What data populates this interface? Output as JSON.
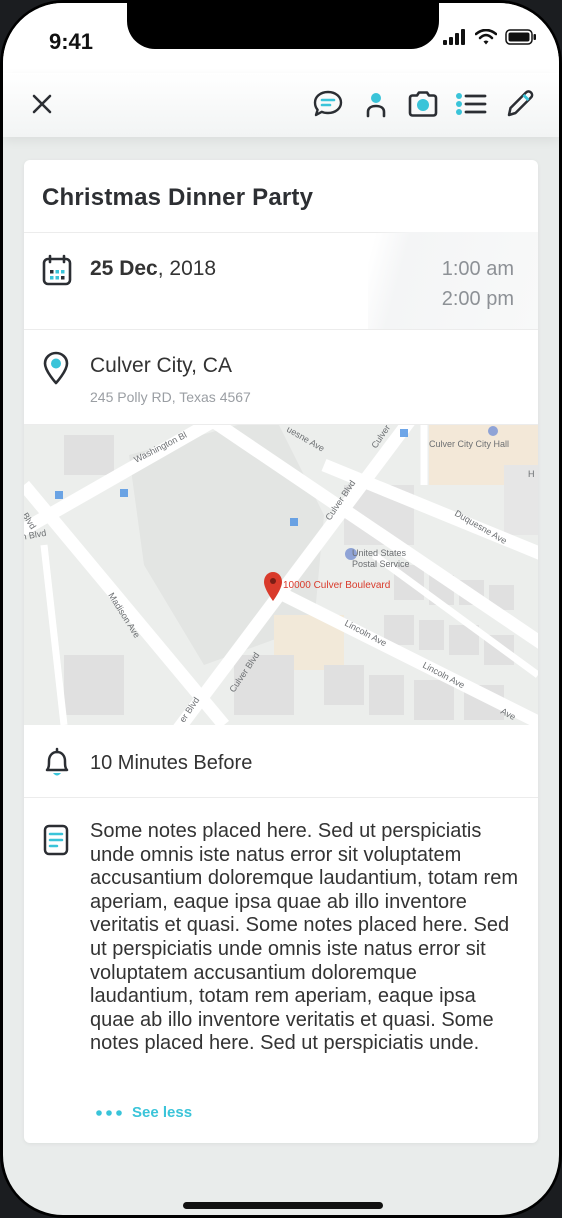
{
  "status": {
    "time": "9:41"
  },
  "toolbar": {
    "icons": [
      "close-icon",
      "chat-icon",
      "person-icon",
      "camera-icon",
      "list-icon",
      "pencil-icon"
    ]
  },
  "event": {
    "title": "Christmas Dinner Party",
    "date_bold": "25 Dec",
    "date_rest": ", 2018",
    "start_time": "1:00 am",
    "end_time": "2:00 pm",
    "location_name": "Culver City, CA",
    "location_address": "245 Polly RD, Texas 4567",
    "reminder": "10 Minutes Before",
    "notes": "Some notes placed here. Sed ut perspiciatis unde omnis iste natus error sit voluptatem accusantium doloremque laudantium, totam rem aperiam, eaque ipsa quae ab illo inventore veritatis et quasi. Some notes placed here. Sed ut perspiciatis unde omnis iste natus error sit voluptatem accusantium doloremque laudantium, totam rem aperiam, eaque ipsa quae ab illo inventore veritatis et quasi. Some notes placed here. Sed ut perspiciatis unde.",
    "see_less": "See less"
  },
  "map": {
    "pin_label": "10000 Culver Boulevard",
    "labels": {
      "washington": "Washington Bl",
      "culver_sw": "Culver Blvd",
      "culver_ne": "Culver Blvd",
      "culver_top": "Culver",
      "culver_bottom": "er Blvd",
      "duquesne_top": "uesne Ave",
      "duquesne": "Duquesne Ave",
      "city_hall": "Culver City City Hall",
      "postal_1": "United States",
      "postal_2": "Postal Service",
      "madison": "Madison Ave",
      "lincoln_1": "Lincoln Ave",
      "lincoln_2": "Lincoln Ave",
      "lincoln_3": "Ave",
      "left_blvd_1": "Blvd",
      "left_blvd_2": "n Blvd",
      "h_mark": "H"
    }
  },
  "colors": {
    "accent": "#3ac4d9",
    "pin": "#d93a2b",
    "text": "#333333"
  }
}
